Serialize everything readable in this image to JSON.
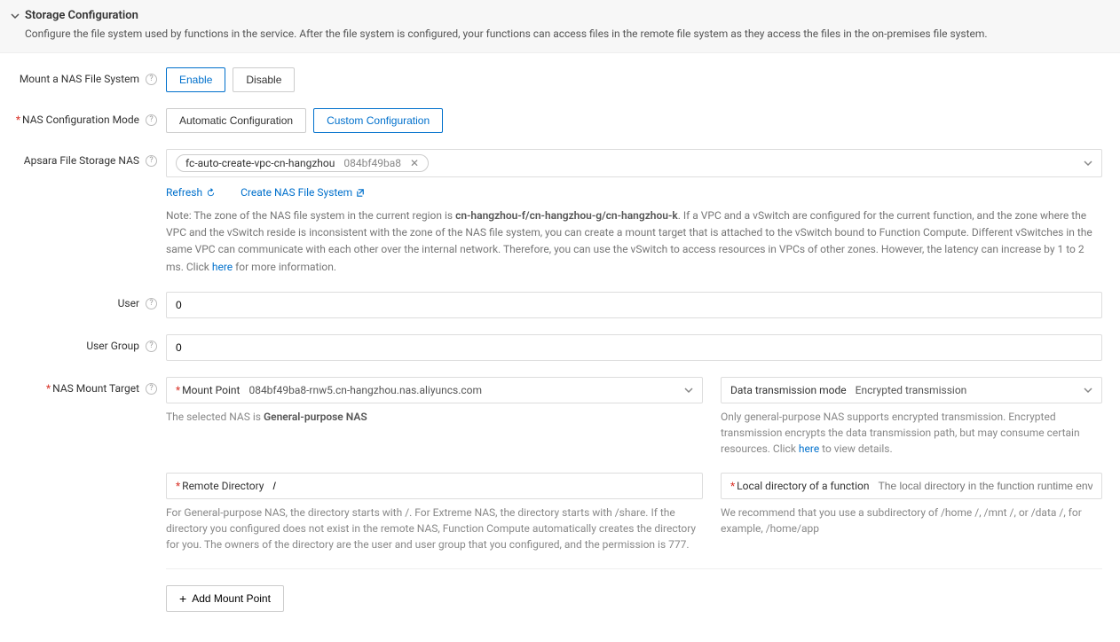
{
  "section": {
    "title": "Storage Configuration",
    "description": "Configure the file system used by functions in the service. After the file system is configured, your functions can access files in the remote file system as they access the files in the on-premises file system."
  },
  "labels": {
    "mount_nas": "Mount a NAS File System",
    "nas_config_mode": "NAS Configuration Mode",
    "apsara_nas": "Apsara File Storage NAS",
    "user": "User",
    "user_group": "User Group",
    "nas_mount_target": "NAS Mount Target"
  },
  "buttons": {
    "enable": "Enable",
    "disable": "Disable",
    "auto_config": "Automatic Configuration",
    "custom_config": "Custom Configuration",
    "refresh": "Refresh",
    "create_nas": "Create NAS File System",
    "add_mount": "Add Mount Point"
  },
  "tag": {
    "name": "fc-auto-create-vpc-cn-hangzhou",
    "id": "084bf49ba8"
  },
  "note": {
    "prefix": "Note: The zone of the NAS file system in the current region is ",
    "zones": "cn-hangzhou-f/cn-hangzhou-g/cn-hangzhou-k",
    "middle": ". If a VPC and a vSwitch are configured for the current function, and the zone where the VPC and the vSwitch reside is inconsistent with the zone of the NAS file system, you can create a mount target that is attached to the vSwitch bound to Function Compute. Different vSwitches in the same VPC can communicate with each other over the internal network. Therefore, you can use the vSwitch to access resources in VPCs of other zones. However, the latency can increase by 1 to 2 ms. Click ",
    "here": "here",
    "suffix": " for more information."
  },
  "fields": {
    "user_value": "0",
    "user_group_value": "0"
  },
  "mount": {
    "mount_point_label": "Mount Point",
    "mount_point_value": "084bf49ba8-rnw5.cn-hangzhou.nas.aliyuncs.com",
    "selected_nas_prefix": "The selected NAS is ",
    "selected_nas_type": "General-purpose NAS",
    "transmission_label": "Data transmission mode",
    "transmission_value": "Encrypted transmission",
    "transmission_note_prefix": "Only general-purpose NAS supports encrypted transmission. Encrypted transmission encrypts the data transmission path, but may consume certain resources. Click ",
    "transmission_note_here": "here",
    "transmission_note_suffix": " to view details.",
    "remote_dir_label": "Remote Directory",
    "remote_dir_value": "/",
    "remote_dir_note": "For General-purpose NAS, the directory starts with /. For Extreme NAS, the directory starts with /share. If the directory you configured does not exist in the remote NAS, Function Compute automatically creates the directory for you. The owners of the directory are the user and user group that you configured, and the permission is 777.",
    "local_dir_label": "Local directory of a function",
    "local_dir_placeholder": "The local directory in the function runtime environment",
    "local_dir_note": "We recommend that you use a subdirectory of /home /, /mnt /, or /data /, for example, /home/app"
  }
}
